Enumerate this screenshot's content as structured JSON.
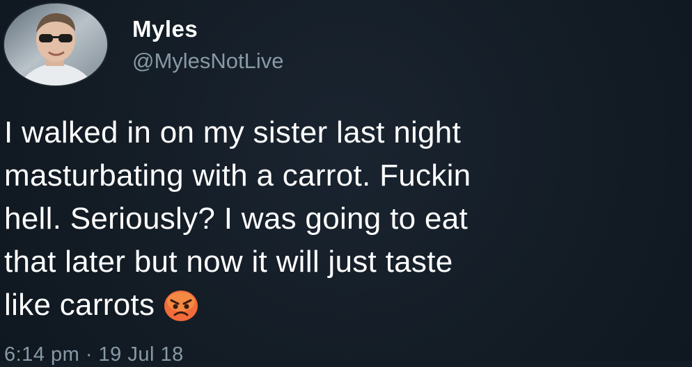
{
  "user": {
    "display_name": "Myles",
    "handle": "@MylesNotLive"
  },
  "tweet": {
    "lines": [
      "I walked in on my sister last night",
      "masturbating with a carrot. Fuckin",
      "hell. Seriously? I was going to eat",
      "that later but now it will just taste",
      "like carrots"
    ],
    "emoji": "angry-face-emoji",
    "timestamp": "6:14 pm · 19 Jul 18"
  },
  "colors": {
    "background": "#141d26",
    "primary_text": "#ffffff",
    "secondary_text": "#8899a6",
    "emoji_fill": "#f26b3a"
  }
}
